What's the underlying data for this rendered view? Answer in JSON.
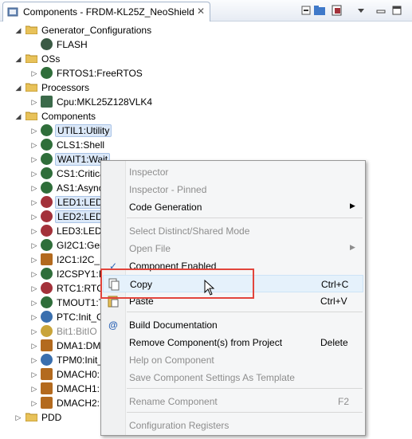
{
  "view": {
    "title": "Components - FRDM-KL25Z_NeoShield",
    "close_glyph": "✕",
    "toolbar_icons": [
      "collapse-icon",
      "folder-icon",
      "inspector-icon",
      "view-menu-icon",
      "minimize-icon",
      "maximize-icon"
    ]
  },
  "tree": {
    "nodes": [
      {
        "label": "Generator_Configurations",
        "expanded": true
      },
      {
        "label": "FLASH"
      },
      {
        "label": "OSs",
        "expanded": true
      },
      {
        "label": "FRTOS1:FreeRTOS"
      },
      {
        "label": "Processors",
        "expanded": true
      },
      {
        "label": "Cpu:MKL25Z128VLK4"
      },
      {
        "label": "Components",
        "expanded": true
      },
      {
        "label": "UTIL1:Utility"
      },
      {
        "label": "CLS1:Shell"
      },
      {
        "label": "WAIT1:Wait"
      },
      {
        "label": "CS1:Critica"
      },
      {
        "label": "AS1:Async"
      },
      {
        "label": "LED1:LED"
      },
      {
        "label": "LED2:LED"
      },
      {
        "label": "LED3:LED"
      },
      {
        "label": "GI2C1:Gen"
      },
      {
        "label": "I2C1:I2C_L"
      },
      {
        "label": "I2CSPY1:I2"
      },
      {
        "label": "RTC1:RTC"
      },
      {
        "label": "TMOUT1:T"
      },
      {
        "label": "PTC:Init_G"
      },
      {
        "label": "Bit1:BitIO"
      },
      {
        "label": "DMA1:DM"
      },
      {
        "label": "TPM0:Init_"
      },
      {
        "label": "DMACH0:"
      },
      {
        "label": "DMACH1:"
      },
      {
        "label": "DMACH2:"
      },
      {
        "label": "PDD",
        "expanded": false
      }
    ]
  },
  "menu": {
    "items": {
      "inspector": "Inspector",
      "inspector_pinned": "Inspector - Pinned",
      "code_generation": "Code Generation",
      "select_distinct": "Select Distinct/Shared Mode",
      "open_file": "Open File",
      "component_enabled": "Component Enabled",
      "copy": "Copy",
      "copy_shortcut": "Ctrl+C",
      "paste": "Paste",
      "paste_shortcut": "Ctrl+V",
      "build_documentation": "Build Documentation",
      "remove_component": "Remove Component(s) from Project",
      "remove_shortcut": "Delete",
      "help_on_component": "Help on Component",
      "save_settings_template": "Save Component Settings As Template",
      "rename_component": "Rename Component",
      "rename_shortcut": "F2",
      "configuration_registers": "Configuration Registers"
    },
    "component_enabled_checked": true,
    "highlighted_item": "Copy"
  },
  "colors": {
    "selection": "#dbe8f8",
    "highlight_box": "#e2453c",
    "folder": "#e8c25a",
    "component_icon": "#2f6e3a"
  }
}
